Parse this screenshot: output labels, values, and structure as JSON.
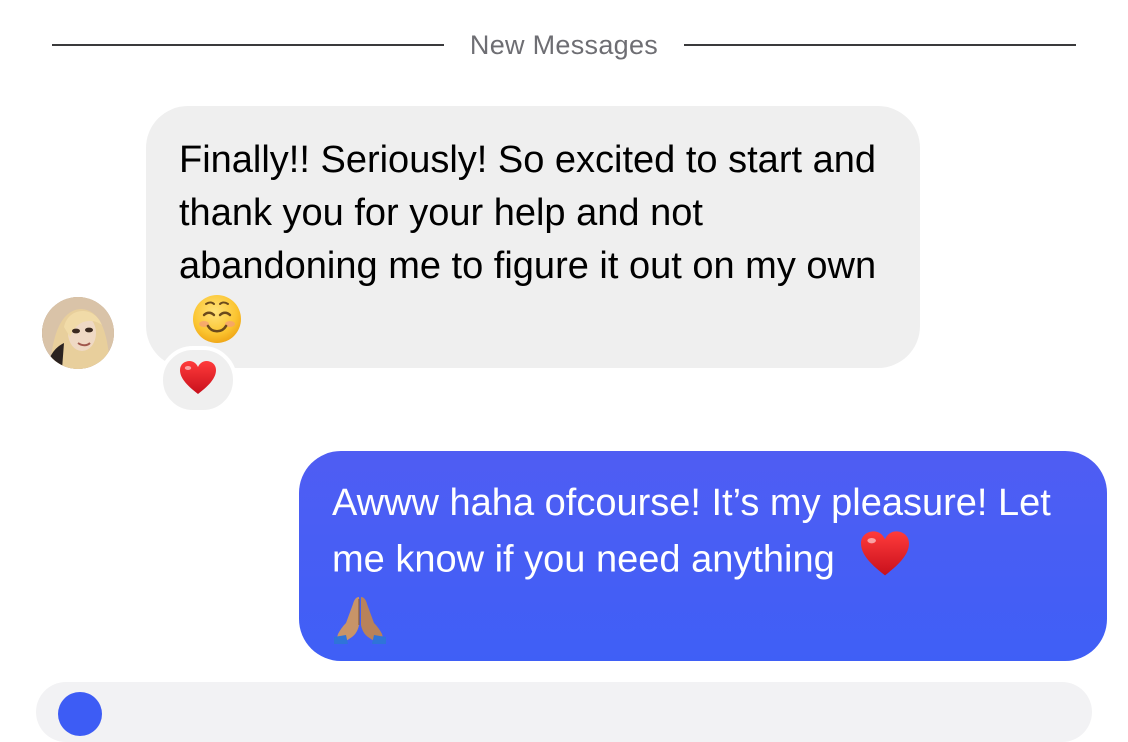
{
  "divider": {
    "label": "New Messages"
  },
  "incoming": {
    "text": "Finally!! Seriously! So excited to start and thank you for your help and not abandoning me to figure it out on my own",
    "emoji": "smiling-face-icon",
    "reaction": "heart-icon"
  },
  "outgoing": {
    "text": "Awww haha ofcourse! It’s my pleasure! Let me know if you need anything",
    "emoji_1": "heart-icon",
    "emoji_2": "folded-hands-icon"
  },
  "colors": {
    "incoming_bubble": "#efefef",
    "outgoing_bubble": "#4458f5",
    "divider_text": "#6e6e73",
    "heart": "#e0202a"
  }
}
